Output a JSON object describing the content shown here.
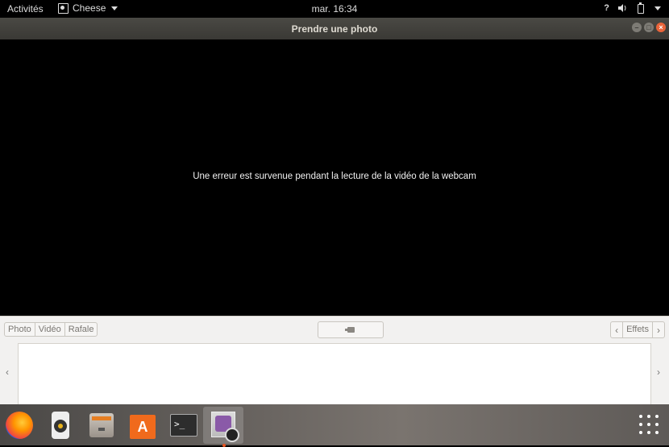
{
  "topbar": {
    "activities": "Activités",
    "app_name": "Cheese",
    "clock": "mar. 16:34",
    "help": "?"
  },
  "window": {
    "title": "Prendre une photo"
  },
  "viewport": {
    "error_message": "Une erreur est survenue pendant la lecture de la vidéo de la webcam"
  },
  "toolbar": {
    "modes": [
      "Photo",
      "Vidéo",
      "Rafale"
    ],
    "effects_label": "Effets"
  },
  "thumbnails": {
    "prev": "‹",
    "next": "›"
  },
  "dock": {
    "items": [
      "firefox",
      "rhythmbox",
      "files",
      "ubuntu-software",
      "terminal",
      "cheese"
    ],
    "active": "cheese"
  },
  "colors": {
    "accent": "#e95420",
    "titlebar": "#3d3c38",
    "toolbar_bg": "#f2f1f0"
  }
}
